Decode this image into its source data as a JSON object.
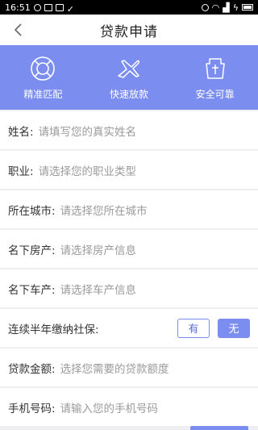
{
  "status_bar": {
    "time": "16:51"
  },
  "header": {
    "title": "贷款申请"
  },
  "features": [
    {
      "label": "精准匹配",
      "icon": "target-icon"
    },
    {
      "label": "快速放款",
      "icon": "airplane-icon"
    },
    {
      "label": "安全可靠",
      "icon": "shield-icon"
    }
  ],
  "form": {
    "name": {
      "label": "姓名:",
      "placeholder": "请填写您的真实姓名"
    },
    "job": {
      "label": "职业:",
      "placeholder": "请选择您的职业类型"
    },
    "city": {
      "label": "所在城市:",
      "placeholder": "请选择您所在城市"
    },
    "house": {
      "label": "名下房产:",
      "placeholder": "请选择房产信息"
    },
    "car": {
      "label": "名下车产:",
      "placeholder": "请选择车产信息"
    },
    "social": {
      "label": "连续半年缴纳社保:",
      "yes": "有",
      "no": "无",
      "selected": "no"
    },
    "amount": {
      "label": "贷款金额:",
      "placeholder": "选择您需要的贷款额度"
    },
    "phone": {
      "label": "手机号码:",
      "placeholder": "请输入您的手机号码"
    }
  },
  "colors": {
    "accent": "#7b8ef0"
  }
}
